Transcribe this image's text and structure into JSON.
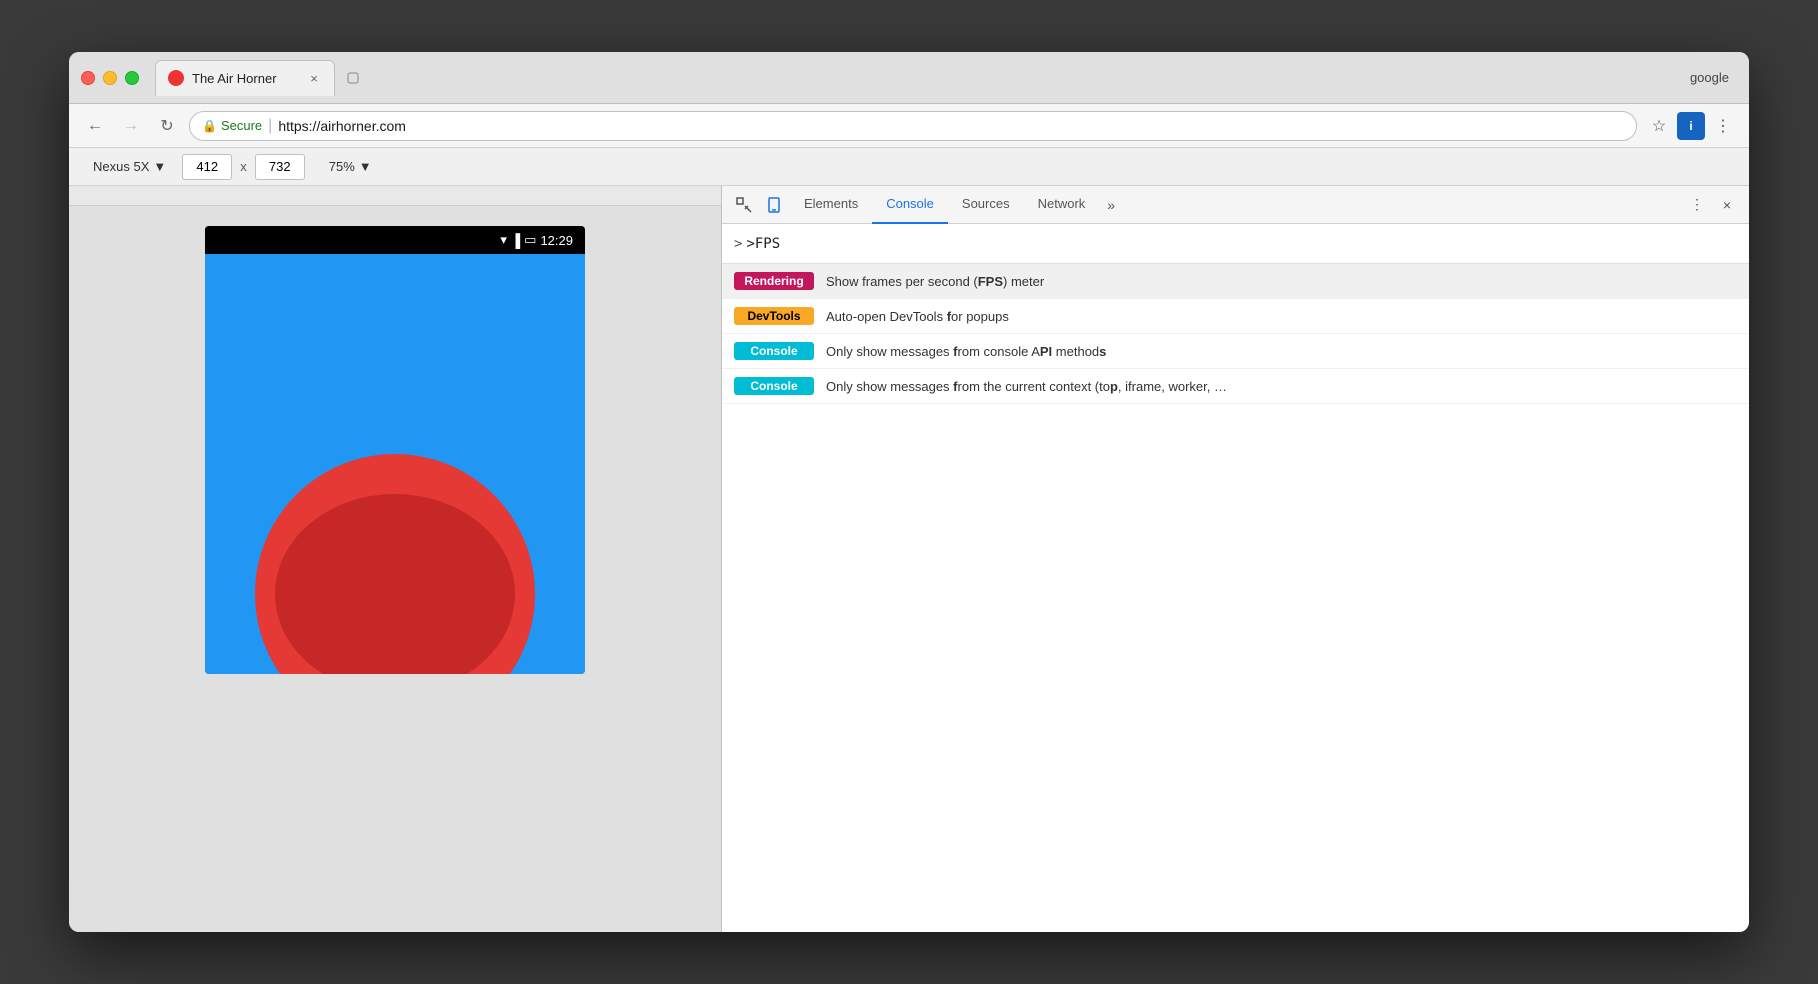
{
  "browser": {
    "traffic_lights": {
      "close": "close",
      "minimize": "minimize",
      "maximize": "maximize"
    },
    "tab": {
      "title": "The Air Horner",
      "close_label": "×"
    },
    "google_text": "google",
    "nav": {
      "back": "←",
      "forward": "→",
      "refresh": "↻",
      "secure_label": "Secure",
      "url": "https://airhorner.com",
      "separator": "|"
    },
    "device_toolbar": {
      "device_name": "Nexus 5X",
      "width": "412",
      "x_label": "x",
      "height": "732",
      "zoom": "75%"
    }
  },
  "devtools": {
    "tabs": [
      {
        "id": "elements",
        "label": "Elements",
        "active": false
      },
      {
        "id": "console",
        "label": "Console",
        "active": true
      },
      {
        "id": "sources",
        "label": "Sources",
        "active": false
      },
      {
        "id": "network",
        "label": "Network",
        "active": false
      }
    ],
    "more_tabs": "»",
    "console_input": ">FPS",
    "autocomplete": [
      {
        "badge": "Rendering",
        "badge_class": "badge-rendering",
        "description_parts": [
          {
            "text": "Show frames per second (",
            "bold": false
          },
          {
            "text": "FPS",
            "bold": true
          },
          {
            "text": ") meter",
            "bold": false
          }
        ],
        "description": "Show frames per second (FPS) meter"
      },
      {
        "badge": "DevTools",
        "badge_class": "badge-devtools",
        "description_parts": [
          {
            "text": "Auto-open DevTools ",
            "bold": false
          },
          {
            "text": "f",
            "bold": true
          },
          {
            "text": "or popups",
            "bold": false
          }
        ],
        "description": "Auto-open DevTools for popups"
      },
      {
        "badge": "Console",
        "badge_class": "badge-console",
        "description_parts": [
          {
            "text": "Only show messages ",
            "bold": false
          },
          {
            "text": "f",
            "bold": true
          },
          {
            "text": "rom console A",
            "bold": false
          },
          {
            "text": "PI",
            "bold": true
          },
          {
            "text": " method",
            "bold": false
          },
          {
            "text": "s",
            "bold": true
          }
        ],
        "description": "Only show messages from console API methods"
      },
      {
        "badge": "Console",
        "badge_class": "badge-console",
        "description_parts": [
          {
            "text": "Only show messages ",
            "bold": false
          },
          {
            "text": "f",
            "bold": true
          },
          {
            "text": "rom the current context (to",
            "bold": false
          },
          {
            "text": "p",
            "bold": true
          },
          {
            "text": ", iframe, worker, …",
            "bold": false
          }
        ],
        "description": "Only show messages from the current context (top, iframe, worker, …"
      }
    ]
  },
  "phone": {
    "time": "12:29",
    "screen_color": "#2196f3"
  }
}
